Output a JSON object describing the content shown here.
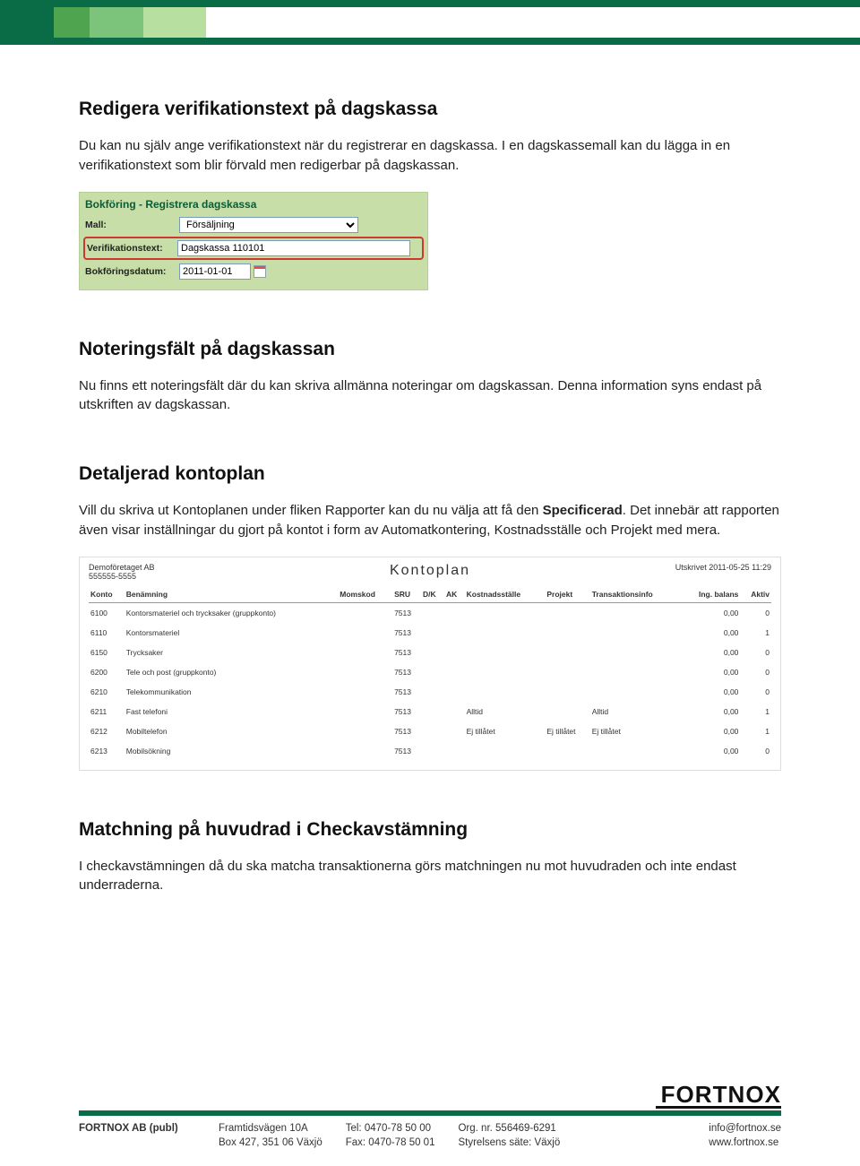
{
  "sections": {
    "s1": {
      "heading": "Redigera verifikationstext på dagskassa",
      "para": "Du kan nu själv ange verifikationstext när du registrerar en dagskassa. I en dagskassemall kan du lägga in en verifikationstext som blir förvald men redigerbar på dagskassan."
    },
    "s2": {
      "heading": "Noteringsfält på dagskassan",
      "para": "Nu finns ett noteringsfält där du kan skriva allmänna noteringar om dagskassan. Denna information syns endast på utskriften av dagskassan."
    },
    "s3": {
      "heading": "Detaljerad kontoplan",
      "para_a": "Vill du skriva ut Kontoplanen under fliken Rapporter kan du nu välja att få den ",
      "para_b_bold": "Specificerad",
      "para_c": ". Det innebär att rapporten även visar inställningar du gjort på kontot i form av Automatkontering, Kostnadsställe och Projekt med mera."
    },
    "s4": {
      "heading": "Matchning på huvudrad i Checkavstämning",
      "para": "I checkavstämningen då du ska matcha transaktionerna görs matchningen nu mot huvudraden och inte endast underraderna."
    }
  },
  "bokforing": {
    "title": "Bokföring - Registrera dagskassa",
    "mall_label": "Mall:",
    "mall_value": "Försäljning",
    "verif_label": "Verifikationstext:",
    "verif_value": "Dagskassa 110101",
    "date_label": "Bokföringsdatum:",
    "date_value": "2011-01-01"
  },
  "kontoplan": {
    "company": "Demoföretaget AB",
    "orgnr": "555555-5555",
    "title": "Kontoplan",
    "printed": "Utskrivet 2011-05-25 11:29",
    "headers": [
      "Konto",
      "Benämning",
      "Momskod",
      "SRU",
      "D/K",
      "AK",
      "Kostnadsställe",
      "Projekt",
      "Transaktionsinfo",
      "Ing. balans",
      "Aktiv"
    ],
    "rows": [
      {
        "k": "6100",
        "b": "Kontorsmateriel och trycksaker (gruppkonto)",
        "m": "",
        "s": "7513",
        "dk": "",
        "ak": "",
        "ks": "",
        "p": "",
        "t": "",
        "ib": "0,00",
        "a": "0"
      },
      {
        "k": "6110",
        "b": "Kontorsmateriel",
        "m": "",
        "s": "7513",
        "dk": "",
        "ak": "",
        "ks": "",
        "p": "",
        "t": "",
        "ib": "0,00",
        "a": "1"
      },
      {
        "k": "6150",
        "b": "Trycksaker",
        "m": "",
        "s": "7513",
        "dk": "",
        "ak": "",
        "ks": "",
        "p": "",
        "t": "",
        "ib": "0,00",
        "a": "0"
      },
      {
        "k": "6200",
        "b": "Tele och post (gruppkonto)",
        "m": "",
        "s": "7513",
        "dk": "",
        "ak": "",
        "ks": "",
        "p": "",
        "t": "",
        "ib": "0,00",
        "a": "0"
      },
      {
        "k": "6210",
        "b": "Telekommunikation",
        "m": "",
        "s": "7513",
        "dk": "",
        "ak": "",
        "ks": "",
        "p": "",
        "t": "",
        "ib": "0,00",
        "a": "0"
      },
      {
        "k": "6211",
        "b": "Fast telefoni",
        "m": "",
        "s": "7513",
        "dk": "",
        "ak": "",
        "ks": "Alltid",
        "p": "",
        "t": "Alltid",
        "ib": "0,00",
        "a": "1"
      },
      {
        "k": "6212",
        "b": "Mobiltelefon",
        "m": "",
        "s": "7513",
        "dk": "",
        "ak": "",
        "ks": "Ej tillåtet",
        "p": "Ej tillåtet",
        "t": "Ej tillåtet",
        "ib": "0,00",
        "a": "1"
      },
      {
        "k": "6213",
        "b": "Mobilsökning",
        "m": "",
        "s": "7513",
        "dk": "",
        "ak": "",
        "ks": "",
        "p": "",
        "t": "",
        "ib": "0,00",
        "a": "0"
      }
    ]
  },
  "footer": {
    "logo": "FORTNOX",
    "company_line": "FORTNOX AB (publ)",
    "addr1": "Framtidsvägen 10A",
    "addr2": "Box 427, 351 06 Växjö",
    "tel": "Tel: 0470-78 50 00",
    "fax": "Fax: 0470-78 50 01",
    "org": "Org. nr. 556469-6291",
    "seat": "Styrelsens säte: Växjö",
    "email": "info@fortnox.se",
    "web": "www.fortnox.se"
  }
}
